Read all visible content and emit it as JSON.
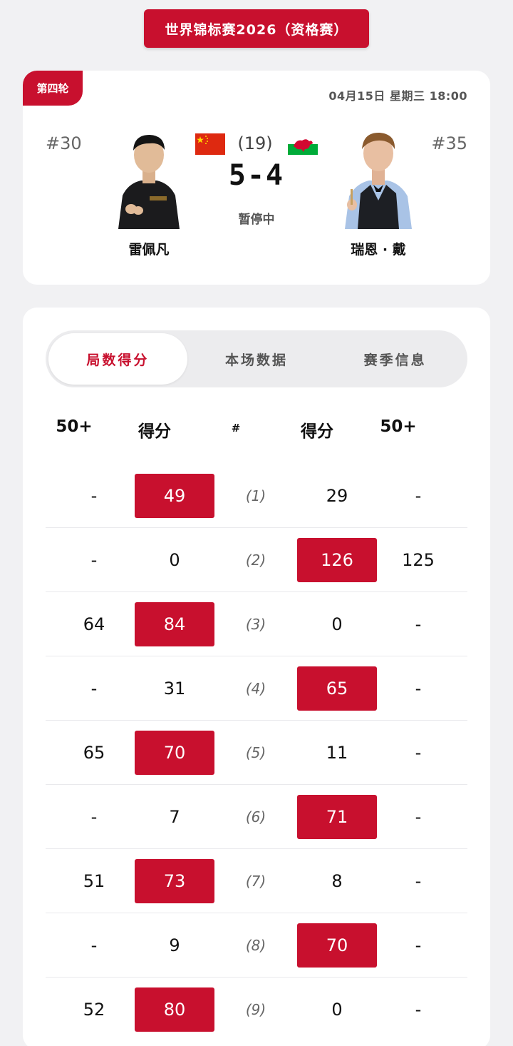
{
  "header": {
    "title": "世界锦标赛2026（资格赛）"
  },
  "match": {
    "round": "第四轮",
    "datetime": "04月15日  星期三  18:00",
    "frames_total": "(19)",
    "score": "5-4",
    "status": "暂停中",
    "player_left": {
      "seed": "#30",
      "name": "雷佩凡",
      "flag": "china-flag-icon"
    },
    "player_right": {
      "seed": "#35",
      "name": "瑞恩 · 戴",
      "flag": "wales-flag-icon"
    }
  },
  "tabs": [
    {
      "label": "局数得分",
      "active": true
    },
    {
      "label": "本场数据",
      "active": false
    },
    {
      "label": "赛季信息",
      "active": false
    }
  ],
  "table": {
    "headers": [
      "50+",
      "得分",
      "#",
      "得分",
      "50+"
    ],
    "rows": [
      {
        "left_break": "-",
        "left_score": "49",
        "frame": "(1)",
        "right_score": "29",
        "right_break": "-",
        "winner": "left"
      },
      {
        "left_break": "-",
        "left_score": "0",
        "frame": "(2)",
        "right_score": "126",
        "right_break": "125",
        "winner": "right"
      },
      {
        "left_break": "64",
        "left_score": "84",
        "frame": "(3)",
        "right_score": "0",
        "right_break": "-",
        "winner": "left"
      },
      {
        "left_break": "-",
        "left_score": "31",
        "frame": "(4)",
        "right_score": "65",
        "right_break": "-",
        "winner": "right"
      },
      {
        "left_break": "65",
        "left_score": "70",
        "frame": "(5)",
        "right_score": "11",
        "right_break": "-",
        "winner": "left"
      },
      {
        "left_break": "-",
        "left_score": "7",
        "frame": "(6)",
        "right_score": "71",
        "right_break": "-",
        "winner": "right"
      },
      {
        "left_break": "51",
        "left_score": "73",
        "frame": "(7)",
        "right_score": "8",
        "right_break": "-",
        "winner": "left"
      },
      {
        "left_break": "-",
        "left_score": "9",
        "frame": "(8)",
        "right_score": "70",
        "right_break": "-",
        "winner": "right"
      },
      {
        "left_break": "52",
        "left_score": "80",
        "frame": "(9)",
        "right_score": "0",
        "right_break": "-",
        "winner": "left"
      }
    ]
  },
  "colors": {
    "accent": "#c8102e",
    "background": "#f1f1f3",
    "card": "#ffffff"
  }
}
